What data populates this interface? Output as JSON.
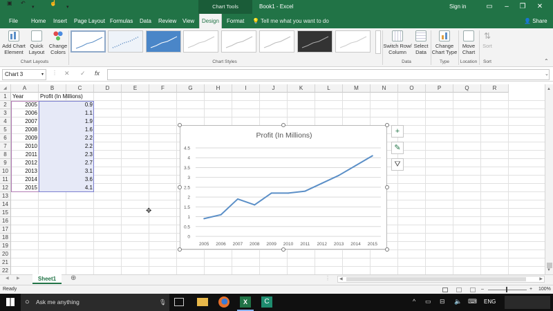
{
  "titlebar": {
    "context_tools": "Chart Tools",
    "document_title": "Book1 - Excel",
    "signin": "Sign in"
  },
  "tabs": [
    "File",
    "Home",
    "Insert",
    "Page Layout",
    "Formulas",
    "Data",
    "Review",
    "View",
    "Design",
    "Format"
  ],
  "active_tab": "Design",
  "tell_me": "Tell me what you want to do",
  "share": "Share",
  "ribbon": {
    "add_chart_element": "Add Chart Element",
    "quick_layout": "Quick Layout",
    "change_colors": "Change Colors",
    "group_chart_layouts": "Chart Layouts",
    "group_chart_styles": "Chart Styles",
    "switch_row_column": "Switch Row/ Column",
    "select_data": "Select Data",
    "group_data": "Data",
    "change_chart_type": "Change Chart Type",
    "group_type": "Type",
    "move_chart": "Move Chart",
    "group_location": "Location",
    "sort": "Sort",
    "group_sort": "Sort"
  },
  "formula_bar": {
    "name_box": "Chart 3",
    "fx": "fx",
    "value": ""
  },
  "columns": [
    "A",
    "B",
    "C",
    "D",
    "E",
    "F",
    "G",
    "H",
    "I",
    "J",
    "K",
    "L",
    "M",
    "N",
    "O",
    "P",
    "Q",
    "R"
  ],
  "rows": [
    "1",
    "2",
    "3",
    "4",
    "5",
    "6",
    "7",
    "8",
    "9",
    "10",
    "11",
    "12",
    "13",
    "14",
    "15",
    "16",
    "17",
    "18",
    "19",
    "20",
    "21",
    "22"
  ],
  "sheet": {
    "header": [
      "Year",
      "Profit (In Millions)"
    ],
    "data": [
      [
        "2005",
        "0.9"
      ],
      [
        "2006",
        "1.1"
      ],
      [
        "2007",
        "1.9"
      ],
      [
        "2008",
        "1.6"
      ],
      [
        "2009",
        "2.2"
      ],
      [
        "2010",
        "2.2"
      ],
      [
        "2011",
        "2.3"
      ],
      [
        "2012",
        "2.7"
      ],
      [
        "2013",
        "3.1"
      ],
      [
        "2014",
        "3.6"
      ],
      [
        "2015",
        "4.1"
      ]
    ]
  },
  "chart_data": {
    "type": "line",
    "title": "Profit (In Millions)",
    "categories": [
      "2005",
      "2006",
      "2007",
      "2008",
      "2009",
      "2010",
      "2011",
      "2012",
      "2013",
      "2014",
      "2015"
    ],
    "values": [
      0.9,
      1.1,
      1.9,
      1.6,
      2.2,
      2.2,
      2.3,
      2.7,
      3.1,
      3.6,
      4.1
    ],
    "yticks": [
      "0",
      "0.5",
      "1",
      "1.5",
      "2",
      "2.5",
      "3",
      "3.5",
      "4",
      "4.5"
    ],
    "ylim": [
      0,
      4.5
    ],
    "grid": true,
    "legend": "none",
    "series_color": "#5b8fc7"
  },
  "sheet_tab": "Sheet1",
  "status": {
    "ready": "Ready",
    "zoom": "100%"
  },
  "taskbar": {
    "search_placeholder": "Ask me anything",
    "language": "ENG"
  },
  "colors": {
    "excel_green": "#217346",
    "selection_fill": "#e6e9f7",
    "selection_border": "#7b7fcf"
  }
}
